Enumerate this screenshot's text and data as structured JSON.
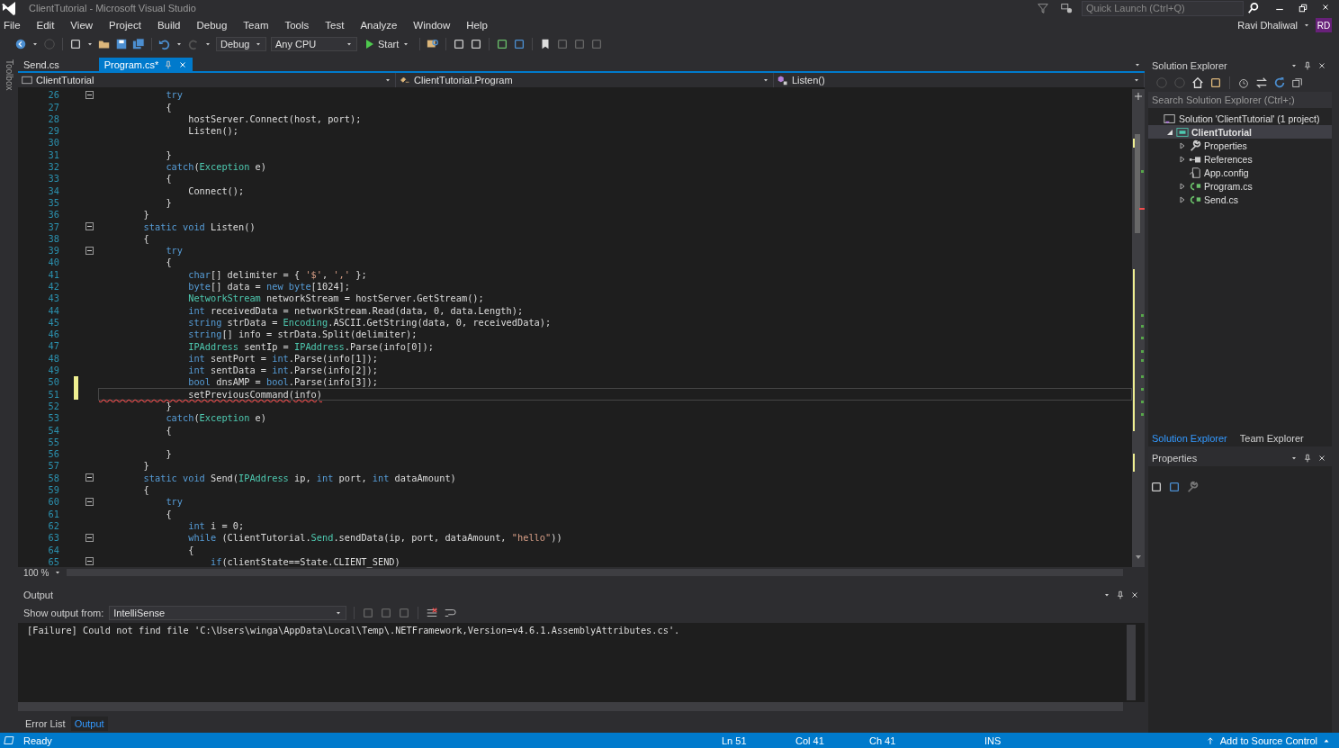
{
  "window": {
    "title": "ClientTutorial - Microsoft Visual Studio",
    "quick_launch": {
      "placeholder": "Quick Launch (Ctrl+Q)"
    },
    "user": {
      "name": "Ravi Dhaliwal",
      "initials": "RD"
    }
  },
  "menu": [
    "File",
    "Edit",
    "View",
    "Project",
    "Build",
    "Debug",
    "Team",
    "Tools",
    "Test",
    "Analyze",
    "Window",
    "Help"
  ],
  "toolbar": {
    "configuration": "Debug",
    "platform": "Any CPU",
    "start": "Start"
  },
  "toolbox": {
    "label": "Toolbox"
  },
  "editor": {
    "tabs": [
      {
        "label": "Send.cs",
        "selected": false
      },
      {
        "label": "Program.cs*",
        "selected": true
      }
    ],
    "nav": [
      "ClientTutorial",
      "ClientTutorial.Program",
      "Listen()"
    ],
    "zoom": "100 %",
    "lines": [
      {
        "n": "26",
        "fold": true,
        "tokens": [
          {
            "text": "            try",
            "kind": "kw"
          }
        ]
      },
      {
        "n": "27",
        "tokens": [
          {
            "text": "            {",
            "kind": "plain"
          }
        ]
      },
      {
        "n": "28",
        "tokens": [
          {
            "text": "                hostServer.Connect(host, port);",
            "kind": "plain"
          }
        ]
      },
      {
        "n": "29",
        "tokens": [
          {
            "text": "                Listen();",
            "kind": "plain"
          }
        ]
      },
      {
        "n": "30"
      },
      {
        "n": "31",
        "tokens": [
          {
            "text": "            }",
            "kind": "plain"
          }
        ]
      },
      {
        "n": "32",
        "tokens": [
          {
            "text": "            catch",
            "kind": "kw"
          },
          {
            "text": "(",
            "kind": "plain"
          },
          {
            "text": "Exception",
            "kind": "type"
          },
          {
            "text": " e)",
            "kind": "plain"
          }
        ]
      },
      {
        "n": "33",
        "tokens": [
          {
            "text": "            {",
            "kind": "plain"
          }
        ]
      },
      {
        "n": "34",
        "tokens": [
          {
            "text": "                Connect();",
            "kind": "plain"
          }
        ]
      },
      {
        "n": "35",
        "tokens": [
          {
            "text": "            }",
            "kind": "plain"
          }
        ]
      },
      {
        "n": "36",
        "tokens": [
          {
            "text": "        }",
            "kind": "plain"
          }
        ]
      },
      {
        "n": "37",
        "fold": true,
        "tokens": [
          {
            "text": "        static void",
            "kind": "kw"
          },
          {
            "text": " Listen()",
            "kind": "plain"
          }
        ]
      },
      {
        "n": "38",
        "tokens": [
          {
            "text": "        {",
            "kind": "plain"
          }
        ]
      },
      {
        "n": "39",
        "fold": true,
        "tokens": [
          {
            "text": "            try",
            "kind": "kw"
          }
        ]
      },
      {
        "n": "40",
        "tokens": [
          {
            "text": "            {",
            "kind": "plain"
          }
        ]
      },
      {
        "n": "41",
        "tokens": [
          {
            "text": "                char",
            "kind": "kw"
          },
          {
            "text": "[] delimiter = { ",
            "kind": "plain"
          },
          {
            "text": "'$'",
            "kind": "str"
          },
          {
            "text": ", ",
            "kind": "plain"
          },
          {
            "text": "','",
            "kind": "str"
          },
          {
            "text": " };",
            "kind": "plain"
          }
        ]
      },
      {
        "n": "42",
        "tokens": [
          {
            "text": "                byte",
            "kind": "kw"
          },
          {
            "text": "[] data = ",
            "kind": "plain"
          },
          {
            "text": "new byte",
            "kind": "kw"
          },
          {
            "text": "[1024];",
            "kind": "plain"
          }
        ]
      },
      {
        "n": "43",
        "tokens": [
          {
            "text": "                NetworkStream",
            "kind": "type"
          },
          {
            "text": " networkStream = hostServer.GetStream();",
            "kind": "plain"
          }
        ]
      },
      {
        "n": "44",
        "tokens": [
          {
            "text": "                int",
            "kind": "kw"
          },
          {
            "text": " receivedData = networkStream.Read(data, 0, data.Length);",
            "kind": "plain"
          }
        ]
      },
      {
        "n": "45",
        "tokens": [
          {
            "text": "                string",
            "kind": "kw"
          },
          {
            "text": " strData = ",
            "kind": "plain"
          },
          {
            "text": "Encoding",
            "kind": "type"
          },
          {
            "text": ".ASCII.GetString(data, 0, receivedData);",
            "kind": "plain"
          }
        ]
      },
      {
        "n": "46",
        "tokens": [
          {
            "text": "                string",
            "kind": "kw"
          },
          {
            "text": "[] info = strData.Split(delimiter);",
            "kind": "plain"
          }
        ]
      },
      {
        "n": "47",
        "tokens": [
          {
            "text": "                IPAddress",
            "kind": "type"
          },
          {
            "text": " sentIp = ",
            "kind": "plain"
          },
          {
            "text": "IPAddress",
            "kind": "type"
          },
          {
            "text": ".Parse(info[0]);",
            "kind": "plain"
          }
        ]
      },
      {
        "n": "48",
        "tokens": [
          {
            "text": "                int",
            "kind": "kw"
          },
          {
            "text": " sentPort = ",
            "kind": "plain"
          },
          {
            "text": "int",
            "kind": "kw"
          },
          {
            "text": ".Parse(info[1]);",
            "kind": "plain"
          }
        ]
      },
      {
        "n": "49",
        "tokens": [
          {
            "text": "                int",
            "kind": "kw"
          },
          {
            "text": " sentData = ",
            "kind": "plain"
          },
          {
            "text": "int",
            "kind": "kw"
          },
          {
            "text": ".Parse(info[2]);",
            "kind": "plain"
          }
        ]
      },
      {
        "n": "50",
        "changed": true,
        "tokens": [
          {
            "text": "                bool",
            "kind": "kw"
          },
          {
            "text": " dnsAMP = ",
            "kind": "plain"
          },
          {
            "text": "bool",
            "kind": "kw"
          },
          {
            "text": ".Parse(info[3]);",
            "kind": "plain"
          }
        ]
      },
      {
        "n": "51",
        "changed": true,
        "current": true,
        "tokens": [
          {
            "text": "                setPreviousCommand(info)",
            "kind": "error"
          }
        ]
      },
      {
        "n": "52",
        "tokens": [
          {
            "text": "            }",
            "kind": "plain"
          }
        ]
      },
      {
        "n": "53",
        "tokens": [
          {
            "text": "            catch",
            "kind": "kw"
          },
          {
            "text": "(",
            "kind": "plain"
          },
          {
            "text": "Exception",
            "kind": "type"
          },
          {
            "text": " e)",
            "kind": "plain"
          }
        ]
      },
      {
        "n": "54",
        "tokens": [
          {
            "text": "            {",
            "kind": "plain"
          }
        ]
      },
      {
        "n": "55"
      },
      {
        "n": "56",
        "tokens": [
          {
            "text": "            }",
            "kind": "plain"
          }
        ]
      },
      {
        "n": "57",
        "tokens": [
          {
            "text": "        }",
            "kind": "plain"
          }
        ]
      },
      {
        "n": "58",
        "fold": true,
        "tokens": [
          {
            "text": "        static void",
            "kind": "kw"
          },
          {
            "text": " Send(",
            "kind": "plain"
          },
          {
            "text": "IPAddress",
            "kind": "type"
          },
          {
            "text": " ip, ",
            "kind": "plain"
          },
          {
            "text": "int",
            "kind": "kw"
          },
          {
            "text": " port, ",
            "kind": "plain"
          },
          {
            "text": "int",
            "kind": "kw"
          },
          {
            "text": " dataAmount)",
            "kind": "plain"
          }
        ]
      },
      {
        "n": "59",
        "tokens": [
          {
            "text": "        {",
            "kind": "plain"
          }
        ]
      },
      {
        "n": "60",
        "fold": true,
        "tokens": [
          {
            "text": "            try",
            "kind": "kw"
          }
        ]
      },
      {
        "n": "61",
        "tokens": [
          {
            "text": "            {",
            "kind": "plain"
          }
        ]
      },
      {
        "n": "62",
        "tokens": [
          {
            "text": "                int",
            "kind": "kw"
          },
          {
            "text": " i = 0;",
            "kind": "plain"
          }
        ]
      },
      {
        "n": "63",
        "fold": true,
        "tokens": [
          {
            "text": "                while",
            "kind": "kw"
          },
          {
            "text": " (ClientTutorial.",
            "kind": "plain"
          },
          {
            "text": "Send",
            "kind": "type"
          },
          {
            "text": ".sendData(ip, port, dataAmount, ",
            "kind": "plain"
          },
          {
            "text": "\"hello\"",
            "kind": "str"
          },
          {
            "text": "))",
            "kind": "plain"
          }
        ]
      },
      {
        "n": "64",
        "tokens": [
          {
            "text": "                {",
            "kind": "plain"
          }
        ]
      },
      {
        "n": "65",
        "fold": true,
        "tokens": [
          {
            "text": "                    if",
            "kind": "kw"
          },
          {
            "text": "(clientState==State.CLIENT_SEND)",
            "kind": "plain"
          }
        ]
      }
    ]
  },
  "output": {
    "title": "Output",
    "source_label": "Show output from:",
    "source": "IntelliSense",
    "text": "[Failure] Could not find file 'C:\\Users\\winga\\AppData\\Local\\Temp\\.NETFramework,Version=v4.6.1.AssemblyAttributes.cs'."
  },
  "bottom_tabs": [
    {
      "label": "Error List",
      "selected": false
    },
    {
      "label": "Output",
      "selected": true
    }
  ],
  "solution_explorer": {
    "title": "Solution Explorer",
    "search": {
      "placeholder": "Search Solution Explorer (Ctrl+;)"
    },
    "tree": [
      {
        "label": "Solution 'ClientTutorial' (1 project)",
        "kind": "solution",
        "selected": false,
        "children": [
          {
            "label": "ClientTutorial",
            "kind": "project",
            "selected": true,
            "expanded": true,
            "children": [
              {
                "label": "Properties",
                "kind": "properties",
                "selected": false,
                "expanded": false
              },
              {
                "label": "References",
                "kind": "references",
                "selected": false,
                "expanded": false
              },
              {
                "label": "App.config",
                "kind": "config",
                "selected": false
              },
              {
                "label": "Program.cs",
                "kind": "csharp",
                "selected": false,
                "expanded": false
              },
              {
                "label": "Send.cs",
                "kind": "csharp",
                "selected": false,
                "expanded": false
              }
            ]
          }
        ]
      }
    ]
  },
  "panel_tabs": [
    {
      "label": "Solution Explorer",
      "selected": true
    },
    {
      "label": "Team Explorer",
      "selected": false
    }
  ],
  "properties": {
    "title": "Properties"
  },
  "status_bar": {
    "state": "Ready",
    "line": "Ln 51",
    "col": "Col 41",
    "ch": "Ch 41",
    "mode": "INS",
    "source_control": "Add to Source Control"
  }
}
